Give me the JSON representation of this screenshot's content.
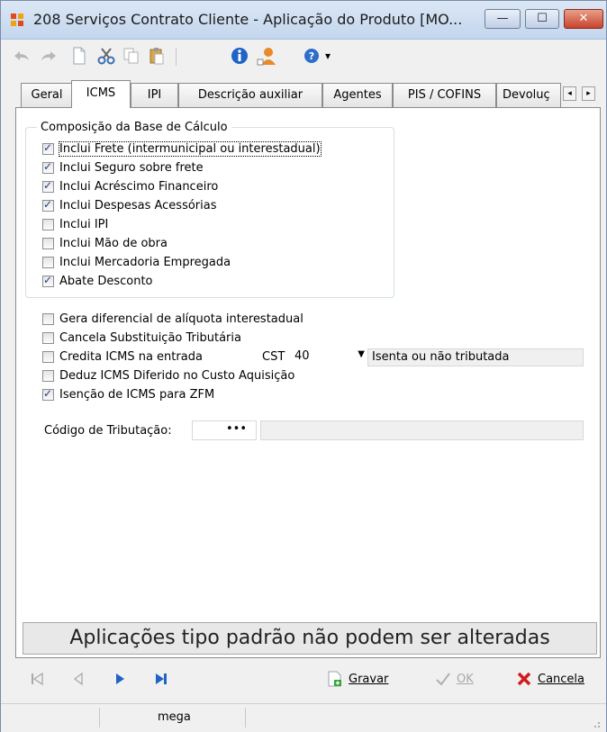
{
  "window": {
    "title": "208 Serviços Contrato Cliente - Aplicação do Produto [MO...",
    "minimize_glyph": "—",
    "maximize_glyph": "☐",
    "close_glyph": "✕"
  },
  "toolbar": {
    "icons": [
      "undo-icon",
      "redo-icon",
      "new-document-icon",
      "cut-icon",
      "copy-icon",
      "paste-icon",
      "info-icon",
      "user-lookup-icon",
      "help-icon"
    ],
    "help_dropdown": "▾"
  },
  "tabs": [
    {
      "label": "Geral",
      "active": false
    },
    {
      "label": "ICMS",
      "active": true
    },
    {
      "label": "IPI",
      "active": false
    },
    {
      "label": "Descrição auxiliar",
      "active": false
    },
    {
      "label": "Agentes",
      "active": false
    },
    {
      "label": "PIS / COFINS",
      "active": false
    },
    {
      "label": "Devoluç",
      "active": false
    }
  ],
  "tab_scroll": {
    "left": "◂",
    "right": "▸"
  },
  "base_calculo": {
    "title": "Composição da Base de Cálculo",
    "items": [
      {
        "label": "Inclui Frete (intermunicipal ou interestadual)",
        "checked": true
      },
      {
        "label": "Inclui Seguro sobre frete",
        "checked": true
      },
      {
        "label": "Inclui Acréscimo Financeiro",
        "checked": true
      },
      {
        "label": "Inclui Despesas Acessórias",
        "checked": true
      },
      {
        "label": "Inclui IPI",
        "checked": false
      },
      {
        "label": "Inclui Mão de obra",
        "checked": false
      },
      {
        "label": "Inclui Mercadoria Empregada",
        "checked": false
      },
      {
        "label": "Abate Desconto",
        "checked": true
      }
    ]
  },
  "options": [
    {
      "label": "Gera diferencial de alíquota interestadual",
      "checked": false
    },
    {
      "label": "Cancela Substituição Tributária",
      "checked": false
    },
    {
      "label": "Credita ICMS na entrada",
      "checked": false
    },
    {
      "label": "Deduz ICMS Diferido no Custo Aquisição",
      "checked": false
    },
    {
      "label": "Isenção de ICMS para ZFM",
      "checked": true
    }
  ],
  "cst": {
    "label": "CST",
    "value": "40",
    "description": "Isenta ou não tributada"
  },
  "codigo_tributacao": {
    "label": "Código de Tributação:",
    "value": "•••",
    "description": ""
  },
  "message": "Aplicações tipo padrão não podem ser alteradas",
  "actions": {
    "save": "Gravar",
    "ok": "OK",
    "cancel": "Cancela"
  },
  "status": {
    "user": "mega"
  },
  "colors": {
    "accent_blue": "#1f63c6",
    "cancel_red": "#d21a1a"
  }
}
